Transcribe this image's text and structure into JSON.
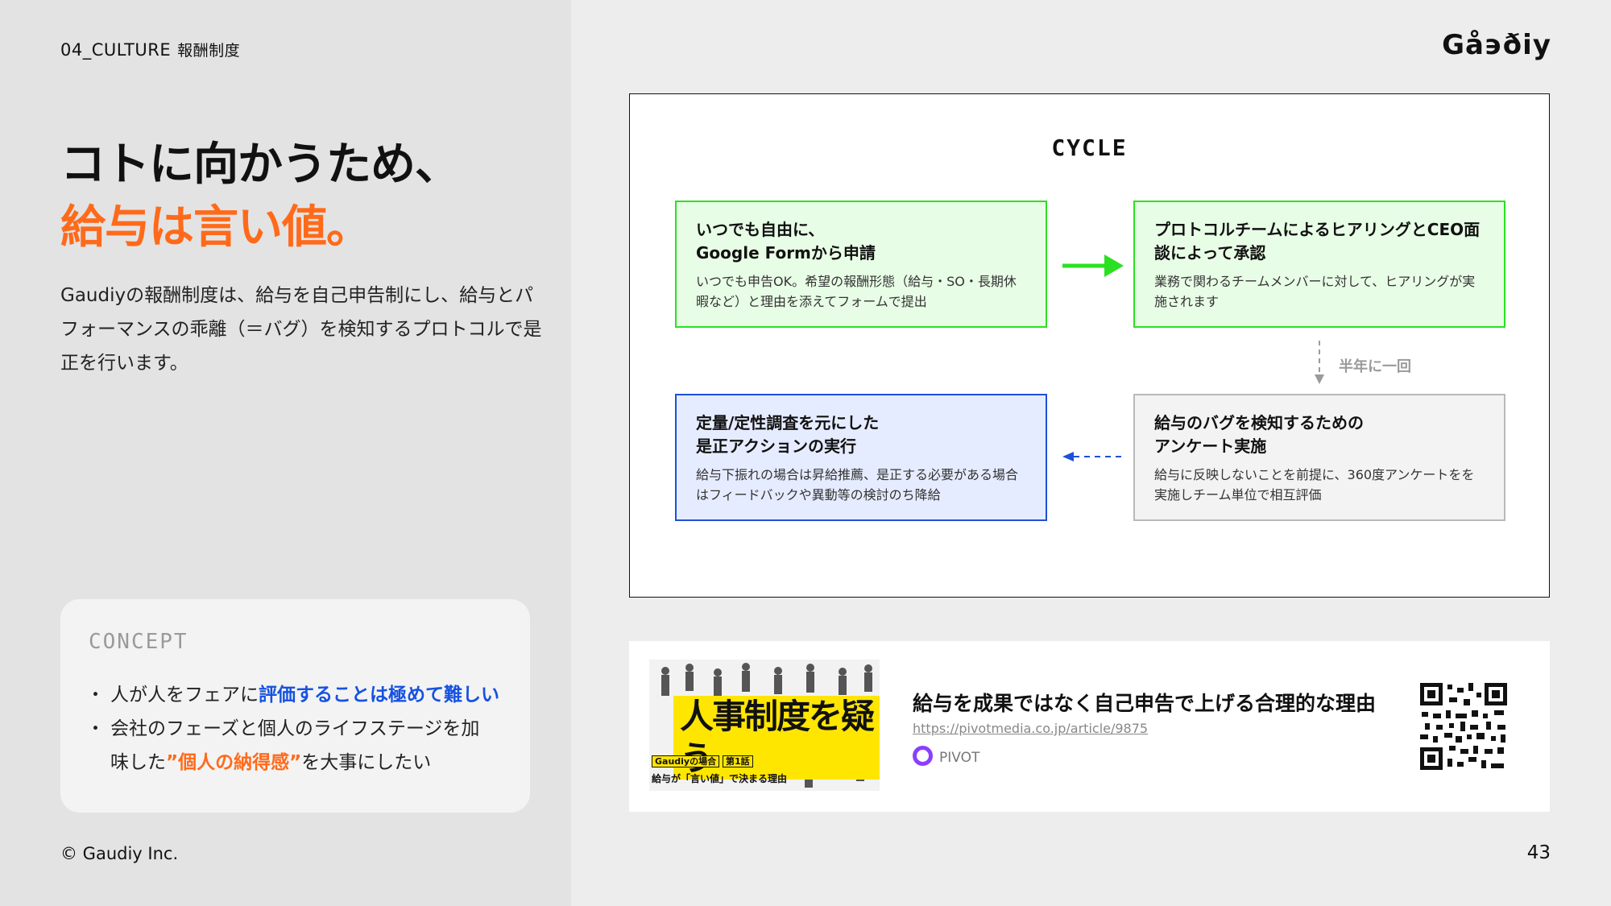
{
  "header": {
    "section": "04_CULTURE",
    "section_sub": "報酬制度",
    "logo": "Gå϶ðiy"
  },
  "headline": {
    "line1": "コトに向かうため、",
    "line2": "給与は言い値。"
  },
  "description": "Gaudiyの報酬制度は、給与を自己申告制にし、給与とパフォーマンスの乖離（＝バグ）を検知するプロトコルで是正を行います。",
  "concept": {
    "title": "CONCEPT",
    "item1_pre": "人が人をフェアに",
    "item1_em": "評価することは極めて難しい",
    "item2_pre": "会社のフェーズと個人のライフステージを加味した",
    "item2_em": "”個人の納得感”",
    "item2_post": "を大事にしたい"
  },
  "cycle": {
    "title": "CYCLE",
    "step1_title": "いつでも自由に、\nGoogle Formから申請",
    "step1_desc": "いつでも申告OK。希望の報酬形態（給与・SO・長期休暇など）と理由を添えてフォームで提出",
    "step2_title": "プロトコルチームによるヒアリングとCEO面談によって承認",
    "step2_desc": "業務で関わるチームメンバーに対して、ヒアリングが実施されます",
    "step3_title": "給与のバグを検知するための\nアンケート実施",
    "step3_desc": "給与に反映しないことを前提に、360度アンケートをを実施しチーム単位で相互評価",
    "step4_title": "定量/定性調査を元にした\n是正アクションの実行",
    "step4_desc": "給与下振れの場合は昇給推薦、是正する必要がある場合はフィードバックや異動等の検討のち降給",
    "interval": "半年に一回",
    "colors": {
      "green": "#2be022",
      "blue": "#1e4fd8",
      "gray": "#b9b9b9"
    }
  },
  "article": {
    "thumb_title": "人事制度を疑う",
    "thumb_tag": "Gaudiyの場合",
    "thumb_ep": "第1話",
    "thumb_sub": "給与が「言い値」で決まる理由",
    "title": "給与を成果ではなく自己申告で上げる合理的な理由",
    "url": "https://pivotmedia.co.jp/article/9875",
    "source": "PIVOT",
    "qr_icon": "qr-code"
  },
  "footer": {
    "copyright": "© Gaudiy Inc.",
    "page": "43"
  }
}
